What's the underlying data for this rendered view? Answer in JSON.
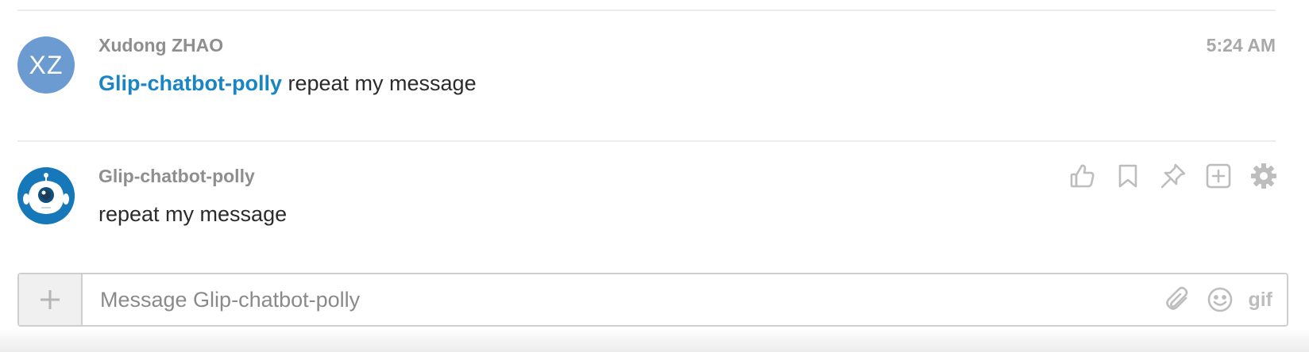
{
  "posts": [
    {
      "author": "Xudong ZHAO",
      "avatar_initials": "XZ",
      "avatar_color": "#6b9bd1",
      "mention": "Glip-chatbot-polly",
      "text": " repeat my message",
      "time": "5:24 AM"
    },
    {
      "author": "Glip-chatbot-polly",
      "avatar_color": "#1678b8",
      "text": "repeat my message",
      "actions": [
        "like-icon",
        "bookmark-icon",
        "pin-icon",
        "add-icon",
        "gear-icon"
      ]
    }
  ],
  "composer": {
    "placeholder": "Message Glip-chatbot-polly",
    "value": "",
    "gif_label": "gif"
  },
  "colors": {
    "mention": "#1a85c5",
    "author": "#8e8e8e",
    "icon": "#bdbdbd"
  }
}
